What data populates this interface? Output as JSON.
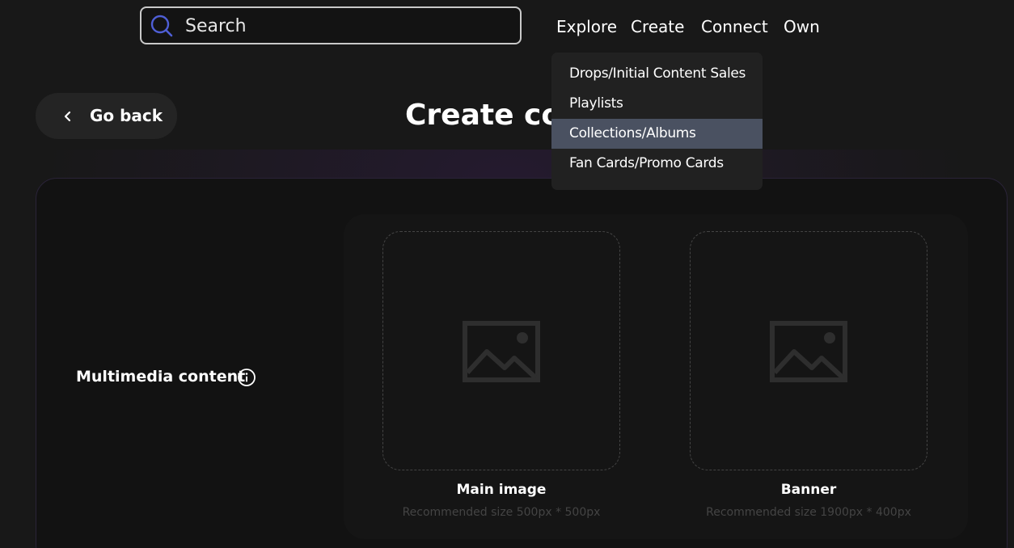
{
  "header": {
    "search": {
      "placeholder": "Search",
      "value": ""
    },
    "nav": [
      {
        "label": "Explore"
      },
      {
        "label": "Create"
      },
      {
        "label": "Connect"
      },
      {
        "label": "Own"
      }
    ]
  },
  "create_menu": {
    "items": [
      {
        "label": "Drops/Initial Content Sales",
        "selected": false
      },
      {
        "label": "Playlists",
        "selected": false
      },
      {
        "label": "Collections/Albums",
        "selected": true
      },
      {
        "label": "Fan Cards/Promo Cards",
        "selected": false
      }
    ]
  },
  "page": {
    "back_label": "Go back",
    "title_visible": "Create coll"
  },
  "form": {
    "multimedia_label": "Multimedia content",
    "uploads": [
      {
        "title": "Main image",
        "hint": "Recommended size 500px * 500px",
        "icon": "image-placeholder-icon"
      },
      {
        "title": "Banner",
        "hint": "Recommended size 1900px * 400px",
        "icon": "image-placeholder-icon"
      }
    ]
  },
  "colors": {
    "background": "#181818",
    "card": "#121212",
    "search_icon_accent": "#4f5fd6",
    "menu_selected": "#4a5161"
  }
}
